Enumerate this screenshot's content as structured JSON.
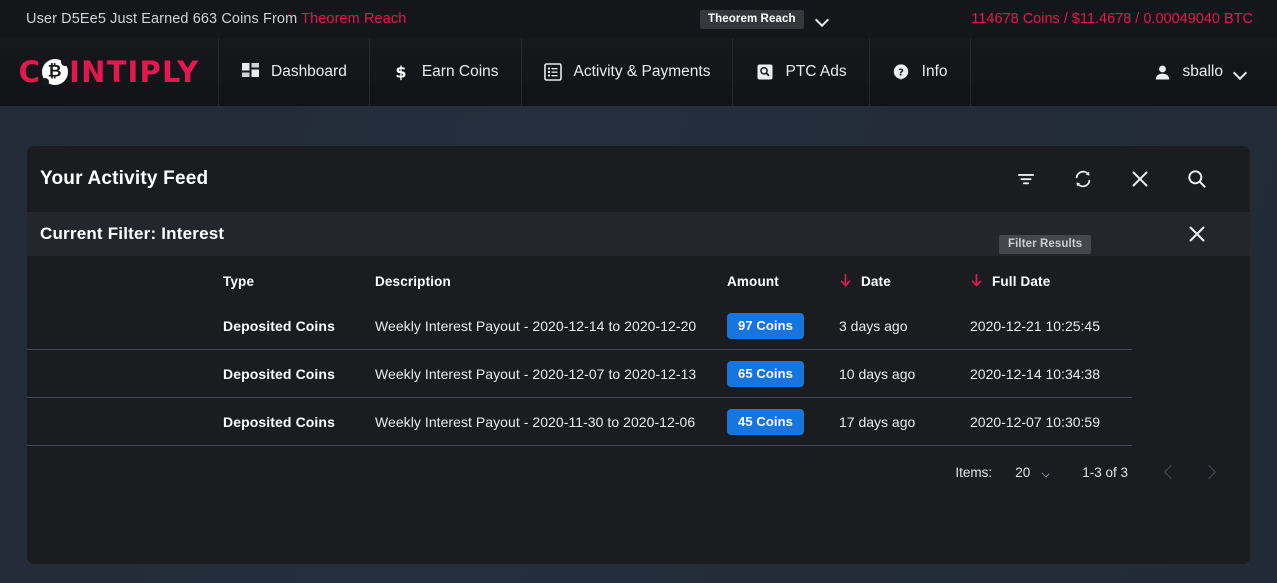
{
  "ticker": {
    "message_prefix": "User D5Ee5 Just Earned 663 Coins From ",
    "message_source": "Theorem Reach",
    "chip_label": "Theorem Reach",
    "balance": "114678 Coins / $11.4678 / 0.00049040 BTC"
  },
  "navbar": {
    "brand_part1": "C",
    "brand_part2": "INTIPLY",
    "items": [
      {
        "label": "Dashboard",
        "icon": "dashboard-icon"
      },
      {
        "label": "Earn Coins",
        "icon": "dollar-icon"
      },
      {
        "label": "Activity & Payments",
        "icon": "list-icon"
      },
      {
        "label": "PTC Ads",
        "icon": "ad-search-icon"
      },
      {
        "label": "Info",
        "icon": "help-icon"
      }
    ],
    "user": "sballo"
  },
  "tooltip": {
    "text": "Filter Results"
  },
  "card": {
    "title": "Your Activity Feed",
    "actions": [
      {
        "name": "filter-icon",
        "title": "Filter Results"
      },
      {
        "name": "refresh-icon",
        "title": "Refresh"
      },
      {
        "name": "close-icon",
        "title": "Clear"
      },
      {
        "name": "search-icon",
        "title": "Search"
      }
    ],
    "filter_text": "Current Filter: Interest",
    "filter_close_icon": "close-icon"
  },
  "table": {
    "headers": {
      "type": "Type",
      "description": "Description",
      "amount": "Amount",
      "date": "Date",
      "full_date": "Full Date"
    },
    "sort_indicator_color": "#e2184f",
    "rows": [
      {
        "type": "Deposited Coins",
        "description": "Weekly Interest Payout - 2020-12-14 to 2020-12-20",
        "amount": "97 Coins",
        "date": "3 days ago",
        "full_date": "2020-12-21 10:25:45"
      },
      {
        "type": "Deposited Coins",
        "description": "Weekly Interest Payout - 2020-12-07 to 2020-12-13",
        "amount": "65 Coins",
        "date": "10 days ago",
        "full_date": "2020-12-14 10:34:38"
      },
      {
        "type": "Deposited Coins",
        "description": "Weekly Interest Payout - 2020-11-30 to 2020-12-06",
        "amount": "45 Coins",
        "date": "17 days ago",
        "full_date": "2020-12-07 10:30:59"
      }
    ]
  },
  "paginator": {
    "items_label": "Items:",
    "page_size": "20",
    "range": "1-3 of 3",
    "prev_icon": "chevron-left-icon",
    "next_icon": "chevron-right-icon"
  },
  "colors": {
    "accent": "#e2184f",
    "badge": "#1775e0",
    "page_bg": "#242d3b",
    "card_bg": "#1a1c20"
  }
}
